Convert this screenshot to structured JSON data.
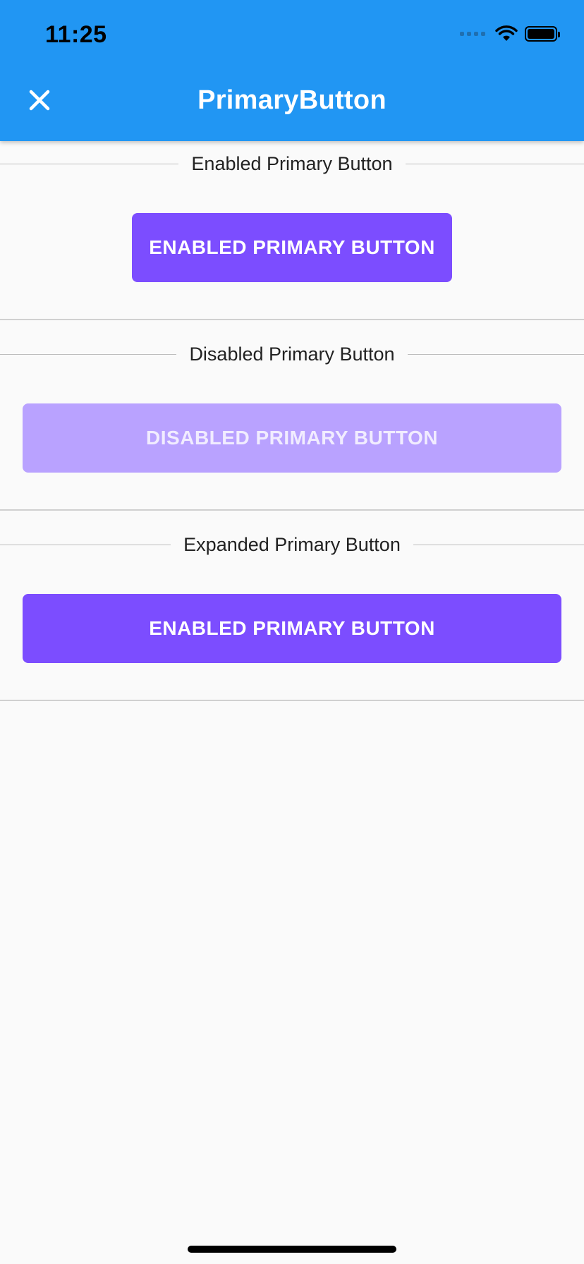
{
  "status_bar": {
    "time": "11:25"
  },
  "app_bar": {
    "title": "PrimaryButton",
    "close_icon": "close-icon",
    "background_color": "#2196f3"
  },
  "sections": [
    {
      "label": "Enabled Primary Button",
      "button": {
        "label": "ENABLED PRIMARY BUTTON",
        "state": "enabled"
      }
    },
    {
      "label": "Disabled Primary Button",
      "button": {
        "label": "DISABLED PRIMARY BUTTON",
        "state": "disabled"
      }
    },
    {
      "label": "Expanded Primary Button",
      "button": {
        "label": "ENABLED PRIMARY BUTTON",
        "state": "enabled"
      }
    }
  ],
  "colors": {
    "primary": "#7c4dff",
    "primary_disabled": "#b9a2ff",
    "background": "#fafafa"
  }
}
